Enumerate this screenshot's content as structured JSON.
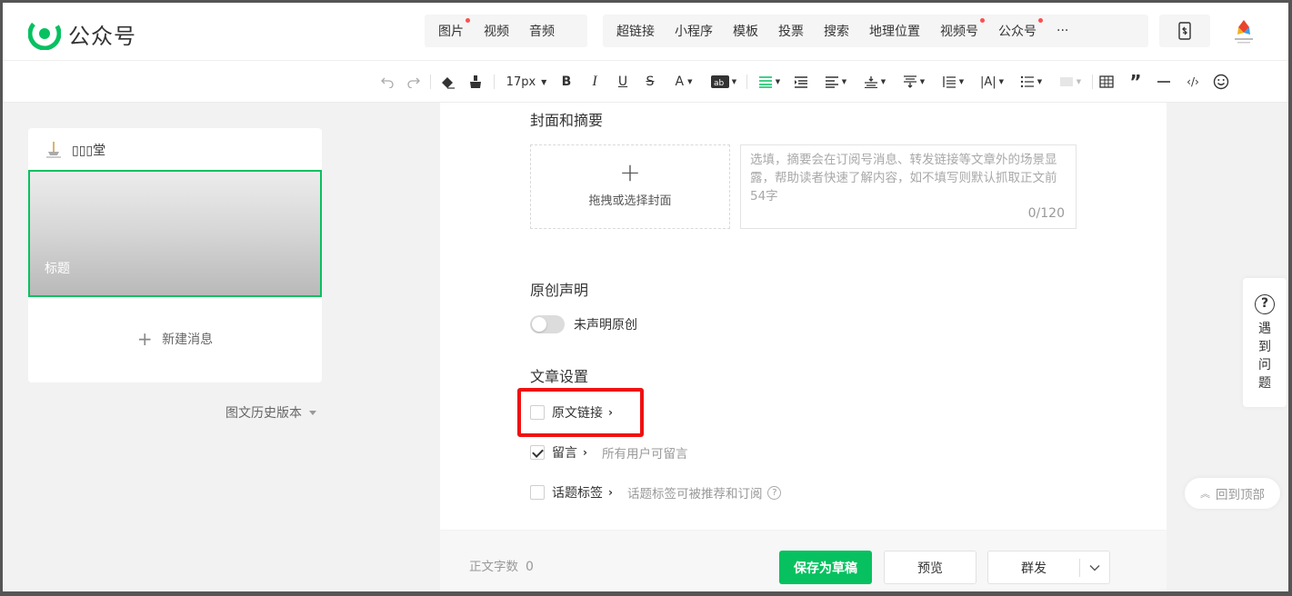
{
  "header": {
    "logo_text": "公众号",
    "media_tools": [
      {
        "label": "图片",
        "dot": true
      },
      {
        "label": "视频",
        "dot": false
      },
      {
        "label": "音频",
        "dot": false
      }
    ],
    "insert_tools": [
      {
        "label": "超链接",
        "dot": false
      },
      {
        "label": "小程序",
        "dot": false
      },
      {
        "label": "模板",
        "dot": false
      },
      {
        "label": "投票",
        "dot": false
      },
      {
        "label": "搜索",
        "dot": false
      },
      {
        "label": "地理位置",
        "dot": false
      },
      {
        "label": "视频号",
        "dot": true
      },
      {
        "label": "公众号",
        "dot": true
      },
      {
        "label": "···",
        "dot": false
      }
    ]
  },
  "format_toolbar": {
    "font_size": "17px"
  },
  "left_panel": {
    "account_name": "▯▯▯堂",
    "cover_title": "标题",
    "new_message": "新建消息",
    "history_versions": "图文历史版本"
  },
  "editor": {
    "cover_section_title": "封面和摘要",
    "cover_upload_text": "拖拽或选择封面",
    "summary_placeholder": "选填，摘要会在订阅号消息、转发链接等文章外的场景显露，帮助读者快速了解内容，如不填写则默认抓取正文前54字",
    "summary_counter": "0/120",
    "original_section_title": "原创声明",
    "original_toggle_label": "未声明原创",
    "original_toggle_on": false,
    "settings_section_title": "文章设置",
    "settings": {
      "source_link": {
        "label": "原文链接",
        "checked": false
      },
      "comments": {
        "label": "留言",
        "checked": true,
        "desc": "所有用户可留言"
      },
      "topic_tags": {
        "label": "话题标签",
        "checked": false,
        "desc": "话题标签可被推荐和订阅"
      }
    }
  },
  "footer": {
    "word_count_label": "正文字数",
    "word_count": "0",
    "save_draft": "保存为草稿",
    "preview": "预览",
    "send": "群发"
  },
  "floating": {
    "help_text": "遇到问题",
    "back_to_top": "回到顶部"
  },
  "colors": {
    "brand_green": "#07c160",
    "highlight_red": "#ee1111",
    "notify_dot": "#fa5151"
  }
}
